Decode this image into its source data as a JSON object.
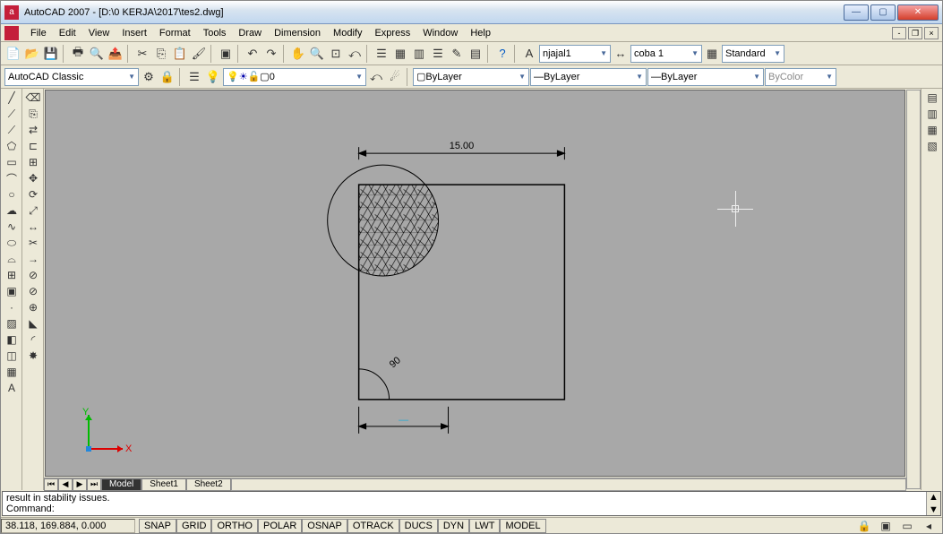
{
  "title": "AutoCAD 2007 - [D:\\0 KERJA\\2017\\tes2.dwg]",
  "menus": [
    "File",
    "Edit",
    "View",
    "Insert",
    "Format",
    "Tools",
    "Draw",
    "Dimension",
    "Modify",
    "Express",
    "Window",
    "Help"
  ],
  "workspace": "AutoCAD Classic",
  "layer_combo": "0",
  "props": {
    "textstyle": "njajal1",
    "dimstyle": "coba 1",
    "tablestyle": "Standard",
    "color": "ByLayer",
    "linetype": "ByLayer",
    "lineweight": "ByLayer",
    "plotstyle": "ByColor"
  },
  "tabs": {
    "active": "Model",
    "others": [
      "Sheet1",
      "Sheet2"
    ]
  },
  "cmd": {
    "line1": "result in stability issues.",
    "prompt": "Command:"
  },
  "coords": "38.118, 169.884, 0.000",
  "status_btns": [
    "SNAP",
    "GRID",
    "ORTHO",
    "POLAR",
    "OSNAP",
    "OTRACK",
    "DUCS",
    "DYN",
    "LWT",
    "MODEL"
  ],
  "chart_data": {
    "type": "cad-drawing",
    "title": "",
    "entities": {
      "rectangle": {
        "width": 15.0,
        "height_approx": 15.0
      },
      "circle": {
        "center_on_rect_upper_left": true,
        "radius_approx": 4.2
      },
      "hatch": {
        "area": "intersection circle∩rect",
        "pattern": "triangular-net"
      },
      "angular_dim": {
        "value": 90,
        "location": "lower-left interior corner"
      },
      "linear_dim_top": {
        "value": 15.0,
        "label": "15.00"
      },
      "linear_dim_bottom": {
        "value_approx": 5.0,
        "label": ""
      }
    },
    "ucs_axes": [
      "X",
      "Y"
    ]
  }
}
